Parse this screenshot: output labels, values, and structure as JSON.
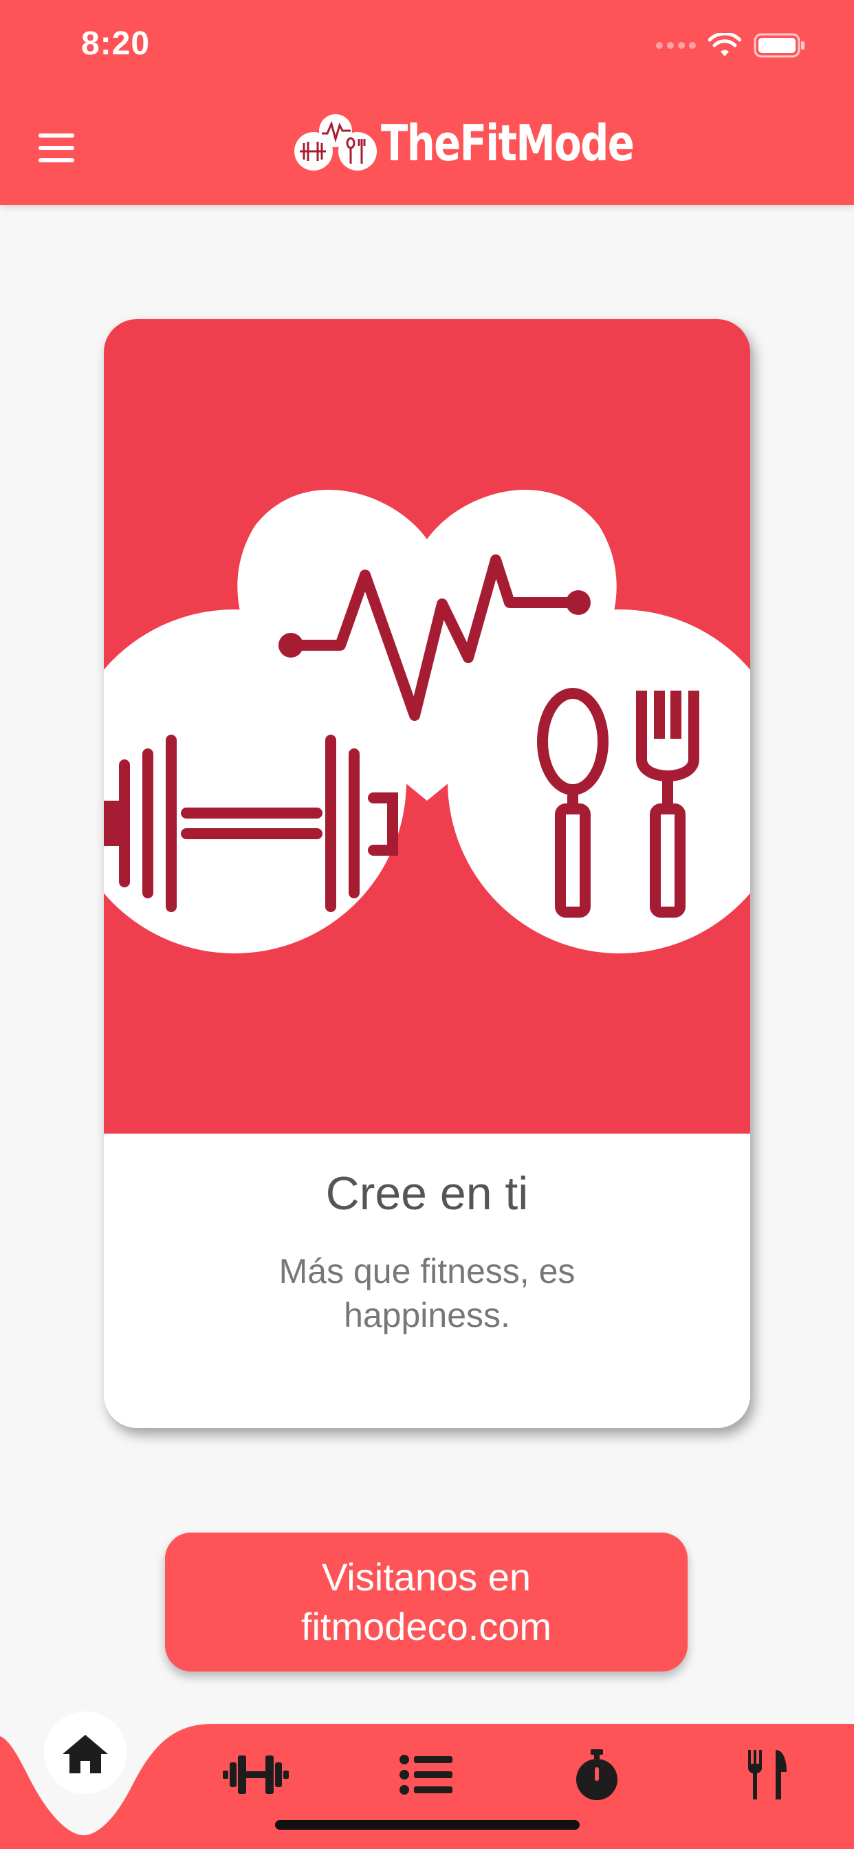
{
  "status_bar": {
    "time": "8:20"
  },
  "header": {
    "brand": "TheFitMode"
  },
  "card": {
    "title": "Cree en ti",
    "subtitle": "Más que fitness, es happiness."
  },
  "cta": {
    "label": "Visitanos en fitmodeco.com"
  },
  "bottom_nav": {
    "items": [
      {
        "icon": "home-icon",
        "active": true
      },
      {
        "icon": "dumbbell-icon",
        "active": false
      },
      {
        "icon": "list-icon",
        "active": false
      },
      {
        "icon": "stopwatch-icon",
        "active": false
      },
      {
        "icon": "utensils-icon",
        "active": false
      }
    ]
  },
  "colors": {
    "primary": "#ff5457",
    "card_art_bg": "#ef3e4e",
    "icon_dark": "#a61c33",
    "background": "#f7f7f7"
  }
}
